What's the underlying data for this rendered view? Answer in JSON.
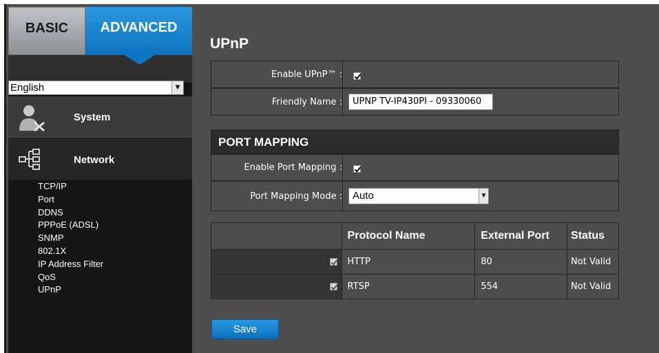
{
  "tabs": {
    "basic": "BASIC",
    "advanced": "ADVANCED"
  },
  "language": {
    "selected": "English"
  },
  "menu": {
    "system": "System",
    "network": "Network",
    "network_items": [
      "TCP/IP",
      "Port",
      "DDNS",
      "PPPoE (ADSL)",
      "SNMP",
      "802.1X",
      "IP Address Filter",
      "QoS",
      "UPnP"
    ]
  },
  "page": {
    "title": "UPnP",
    "enable_upnp_label": "Enable UPnP™ :",
    "enable_upnp_checked": true,
    "friendly_name_label": "Friendly Name :",
    "friendly_name_value": "UPNP TV-IP430PI - 09330060",
    "port_mapping_header": "PORT MAPPING",
    "enable_port_mapping_label": "Enable Port Mapping :",
    "enable_port_mapping_checked": true,
    "port_mapping_mode_label": "Port Mapping Mode :",
    "port_mapping_mode_value": "Auto",
    "table": {
      "headers": [
        "",
        "Protocol Name",
        "External Port",
        "Status"
      ],
      "rows": [
        {
          "checked": true,
          "protocol": "HTTP",
          "port": "80",
          "status": "Not Valid"
        },
        {
          "checked": true,
          "protocol": "RTSP",
          "port": "554",
          "status": "Not Valid"
        }
      ]
    },
    "save_label": "Save"
  },
  "colors": {
    "accent": "#0f76c3",
    "panel": "#4d4d4d",
    "sidebar": "#151515"
  }
}
